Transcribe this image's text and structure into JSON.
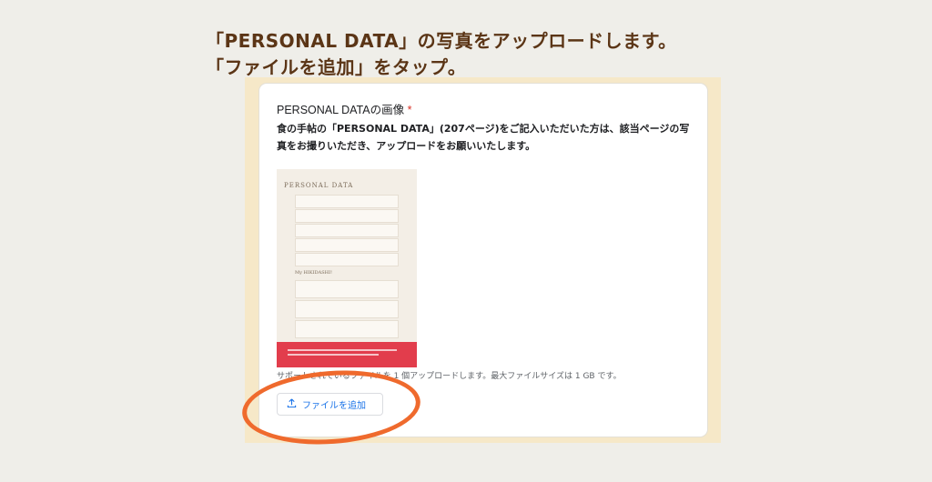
{
  "instruction": {
    "line1": "「PERSONAL DATA」の写真をアップロードします。",
    "line2": "「ファイルを追加」をタップ。"
  },
  "question": {
    "title": "PERSONAL DATAの画像",
    "required_mark": "*",
    "description": "食の手帖の「PERSONAL DATA」(207ページ)をご記入いただいた方は、該当ページの写真をお撮りいただき、アップロードをお願いいたします。"
  },
  "preview": {
    "heading": "PERSONAL DATA",
    "section": "My HIKIDASHI!"
  },
  "upload": {
    "hint": "サポートされているファイルを 1 個アップロードします。最大ファイルサイズは 1 GB です。",
    "button_label": "ファイルを追加",
    "icon": "upload-icon"
  },
  "colors": {
    "accent": "#1a73e8",
    "highlight_ring": "#ef6a2d",
    "instruction_text": "#5b3516",
    "required": "#d93025"
  }
}
